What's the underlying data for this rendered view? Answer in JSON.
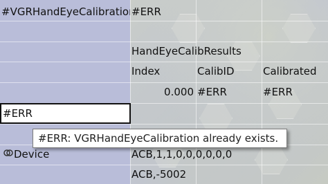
{
  "cells": {
    "r1c1": "#VGRHandEyeCalibration",
    "r1c2": "#ERR",
    "r3c2": "HandEyeCalibResults",
    "r4c2": "Index",
    "r4c3": "CalibID",
    "r4c4": "Calibrated",
    "r5c2": "0.000",
    "r5c3": "#ERR",
    "r5c4": "#ERR",
    "r6c1": "#ERR",
    "r8c1": "Device",
    "r8c2": "ACB,1,1,0,0,0,0,0,0",
    "r9c2": "ACB,-5002"
  },
  "tooltip": {
    "text": "#ERR:  VGRHandEyeCalibration already exists."
  },
  "icons": {
    "device": "device-link-icon"
  }
}
